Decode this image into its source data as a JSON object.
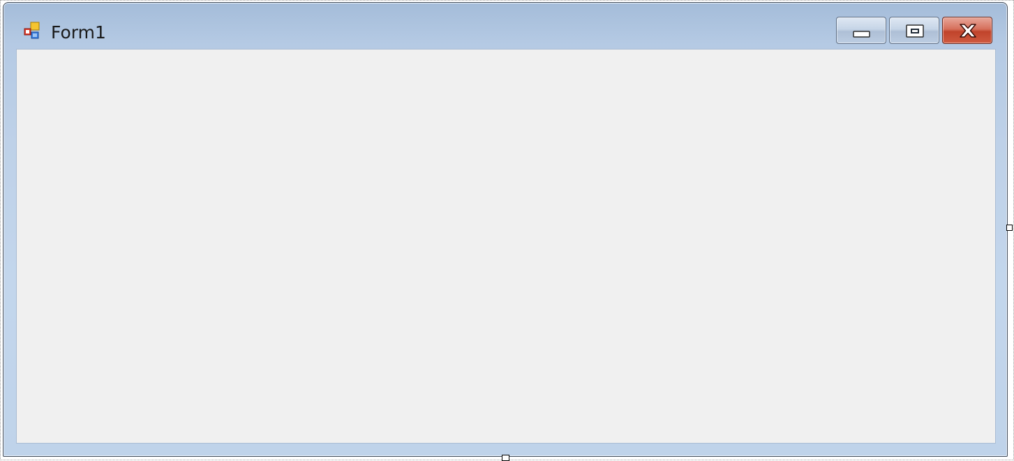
{
  "window": {
    "title": "Form1",
    "icon": "winforms-app-icon"
  },
  "caption_buttons": {
    "minimize": "minimize-icon",
    "maximize": "maximize-icon",
    "close": "close-icon"
  },
  "colors": {
    "frame": "#b5cae4",
    "client": "#f0f0f0",
    "close_button": "#c0432b"
  }
}
